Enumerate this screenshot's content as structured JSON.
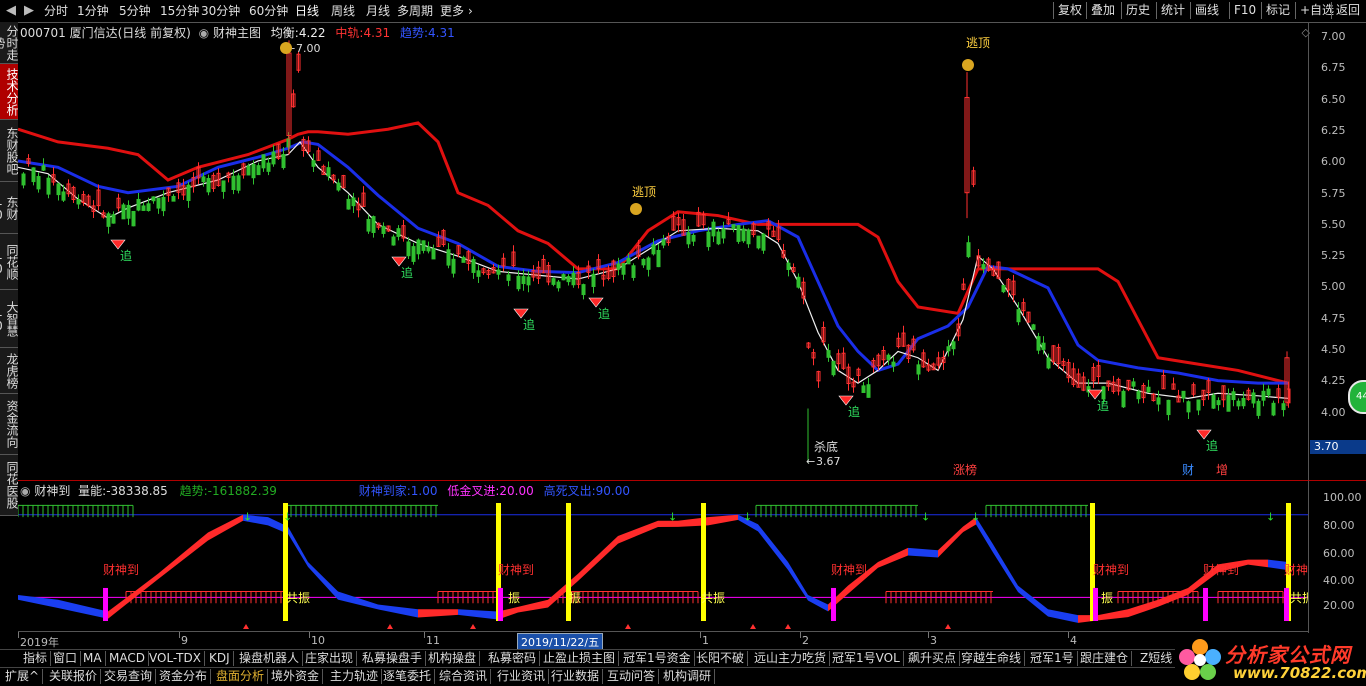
{
  "topnav": {
    "items": [
      "分时",
      "1分钟",
      "5分钟",
      "15分钟",
      "30分钟",
      "60分钟",
      "日线",
      "周线",
      "月线",
      "多周期",
      "更多"
    ],
    "active": "日线",
    "more_arrow": "›"
  },
  "toolbar_right": [
    "复权",
    "叠加",
    "历史",
    "统计",
    "画线",
    "F10",
    "标记",
    "+自选",
    "返回"
  ],
  "sidebar": [
    {
      "label": "分时走势",
      "active": false
    },
    {
      "label": "技术分析",
      "active": true
    },
    {
      "label": "东财股吧",
      "active": false
    },
    {
      "label": "东财10",
      "active": false
    },
    {
      "label": "同花顺10",
      "active": false
    },
    {
      "label": "大智慧10",
      "active": false
    },
    {
      "label": "龙虎榜",
      "active": false
    },
    {
      "label": "资金流向",
      "active": false
    },
    {
      "label": "同花医股",
      "active": false
    }
  ],
  "main_legend": {
    "stock": "000701 厦门信达(日线 前复权)",
    "indicator": "财神主图",
    "ma_label": "均衡:",
    "ma_value": "4.22",
    "mid_label": "中轨:",
    "mid_value": "4.31",
    "trend_label": "趋势:",
    "trend_value": "4.31"
  },
  "price_axis": {
    "ticks": [
      "7.00",
      "6.75",
      "6.50",
      "6.25",
      "6.00",
      "5.75",
      "5.50",
      "5.25",
      "5.00",
      "4.75",
      "4.50",
      "4.25",
      "4.00"
    ],
    "current_price": "3.70"
  },
  "annotations": {
    "high_marker": "7.00",
    "low_marker": "3.67",
    "escape_top_1": "逃顶",
    "escape_top_2": "逃顶",
    "kill_bottom": "杀底",
    "chase": "追",
    "limit_up": "涨榜",
    "cai": "财",
    "zeng": "增"
  },
  "ind_legend": {
    "name": "财神到",
    "vol_label": "量能:",
    "vol_value": "-38338.85",
    "trend_label": "趋势:",
    "trend_value": "-161882.39",
    "arrive_label": "财神到家:",
    "arrive_value": "1.00",
    "low_label": "低金叉进:",
    "low_value": "20.00",
    "high_label": "高死叉出:",
    "high_value": "90.00"
  },
  "ind_axis": {
    "ticks": [
      "100.00",
      "80.00",
      "60.00",
      "40.00",
      "20.00"
    ]
  },
  "ind_labels": {
    "caishen": "财神到",
    "gongzhen": "共振",
    "zhen": "振"
  },
  "time_axis": {
    "labels": [
      "2019年",
      "9",
      "10",
      "11",
      "1",
      "2",
      "3",
      "4"
    ],
    "cursor_date": "2019/11/22/五"
  },
  "tabs_row1": [
    "指标",
    "窗口",
    "MA",
    "MACD",
    "VOL-TDX",
    "KDJ",
    "操盘机器人",
    "庄家出现",
    "私募操盘手",
    "机构操盘",
    "私募密码",
    "止盈止损主图",
    "冠军1号资金",
    "长阳不破",
    "远山主力吃货",
    "冠军1号VOL",
    "飙升买点",
    "穿越生命线",
    "冠军1号",
    "跟庄建仓",
    "Z短线"
  ],
  "tabs_row2": [
    "扩展^",
    "关联报价",
    "交易查询",
    "资金分布",
    "盘面分析",
    "境外资金",
    "主力轨迹",
    "逐笔委托",
    "综合资讯",
    "行业资讯",
    "行业数据",
    "互动问答",
    "机构调研"
  ],
  "tabs_row2_active": "盘面分析",
  "logo": {
    "name": "分析家公式网",
    "url": "www.70822.com"
  },
  "badge": {
    "value": "44"
  },
  "colors": {
    "up": "#ff3030",
    "down": "#30c030",
    "ma_red": "#e01010",
    "ma_blue": "#1a2ee8",
    "accent_yellow": "#ffff00",
    "magenta": "#ff00ff"
  },
  "chart_data": {
    "type": "candlestick",
    "title": "000701 厦门信达(日线 前复权)",
    "y_range": [
      3.65,
      7.05
    ],
    "price_ticks": [
      4.0,
      4.25,
      4.5,
      4.75,
      5.0,
      5.25,
      5.5,
      5.75,
      6.0,
      6.25,
      6.5,
      6.75,
      7.0
    ],
    "high": 7.0,
    "low": 3.67,
    "last": 3.7,
    "indicator_range": [
      0,
      100
    ]
  }
}
